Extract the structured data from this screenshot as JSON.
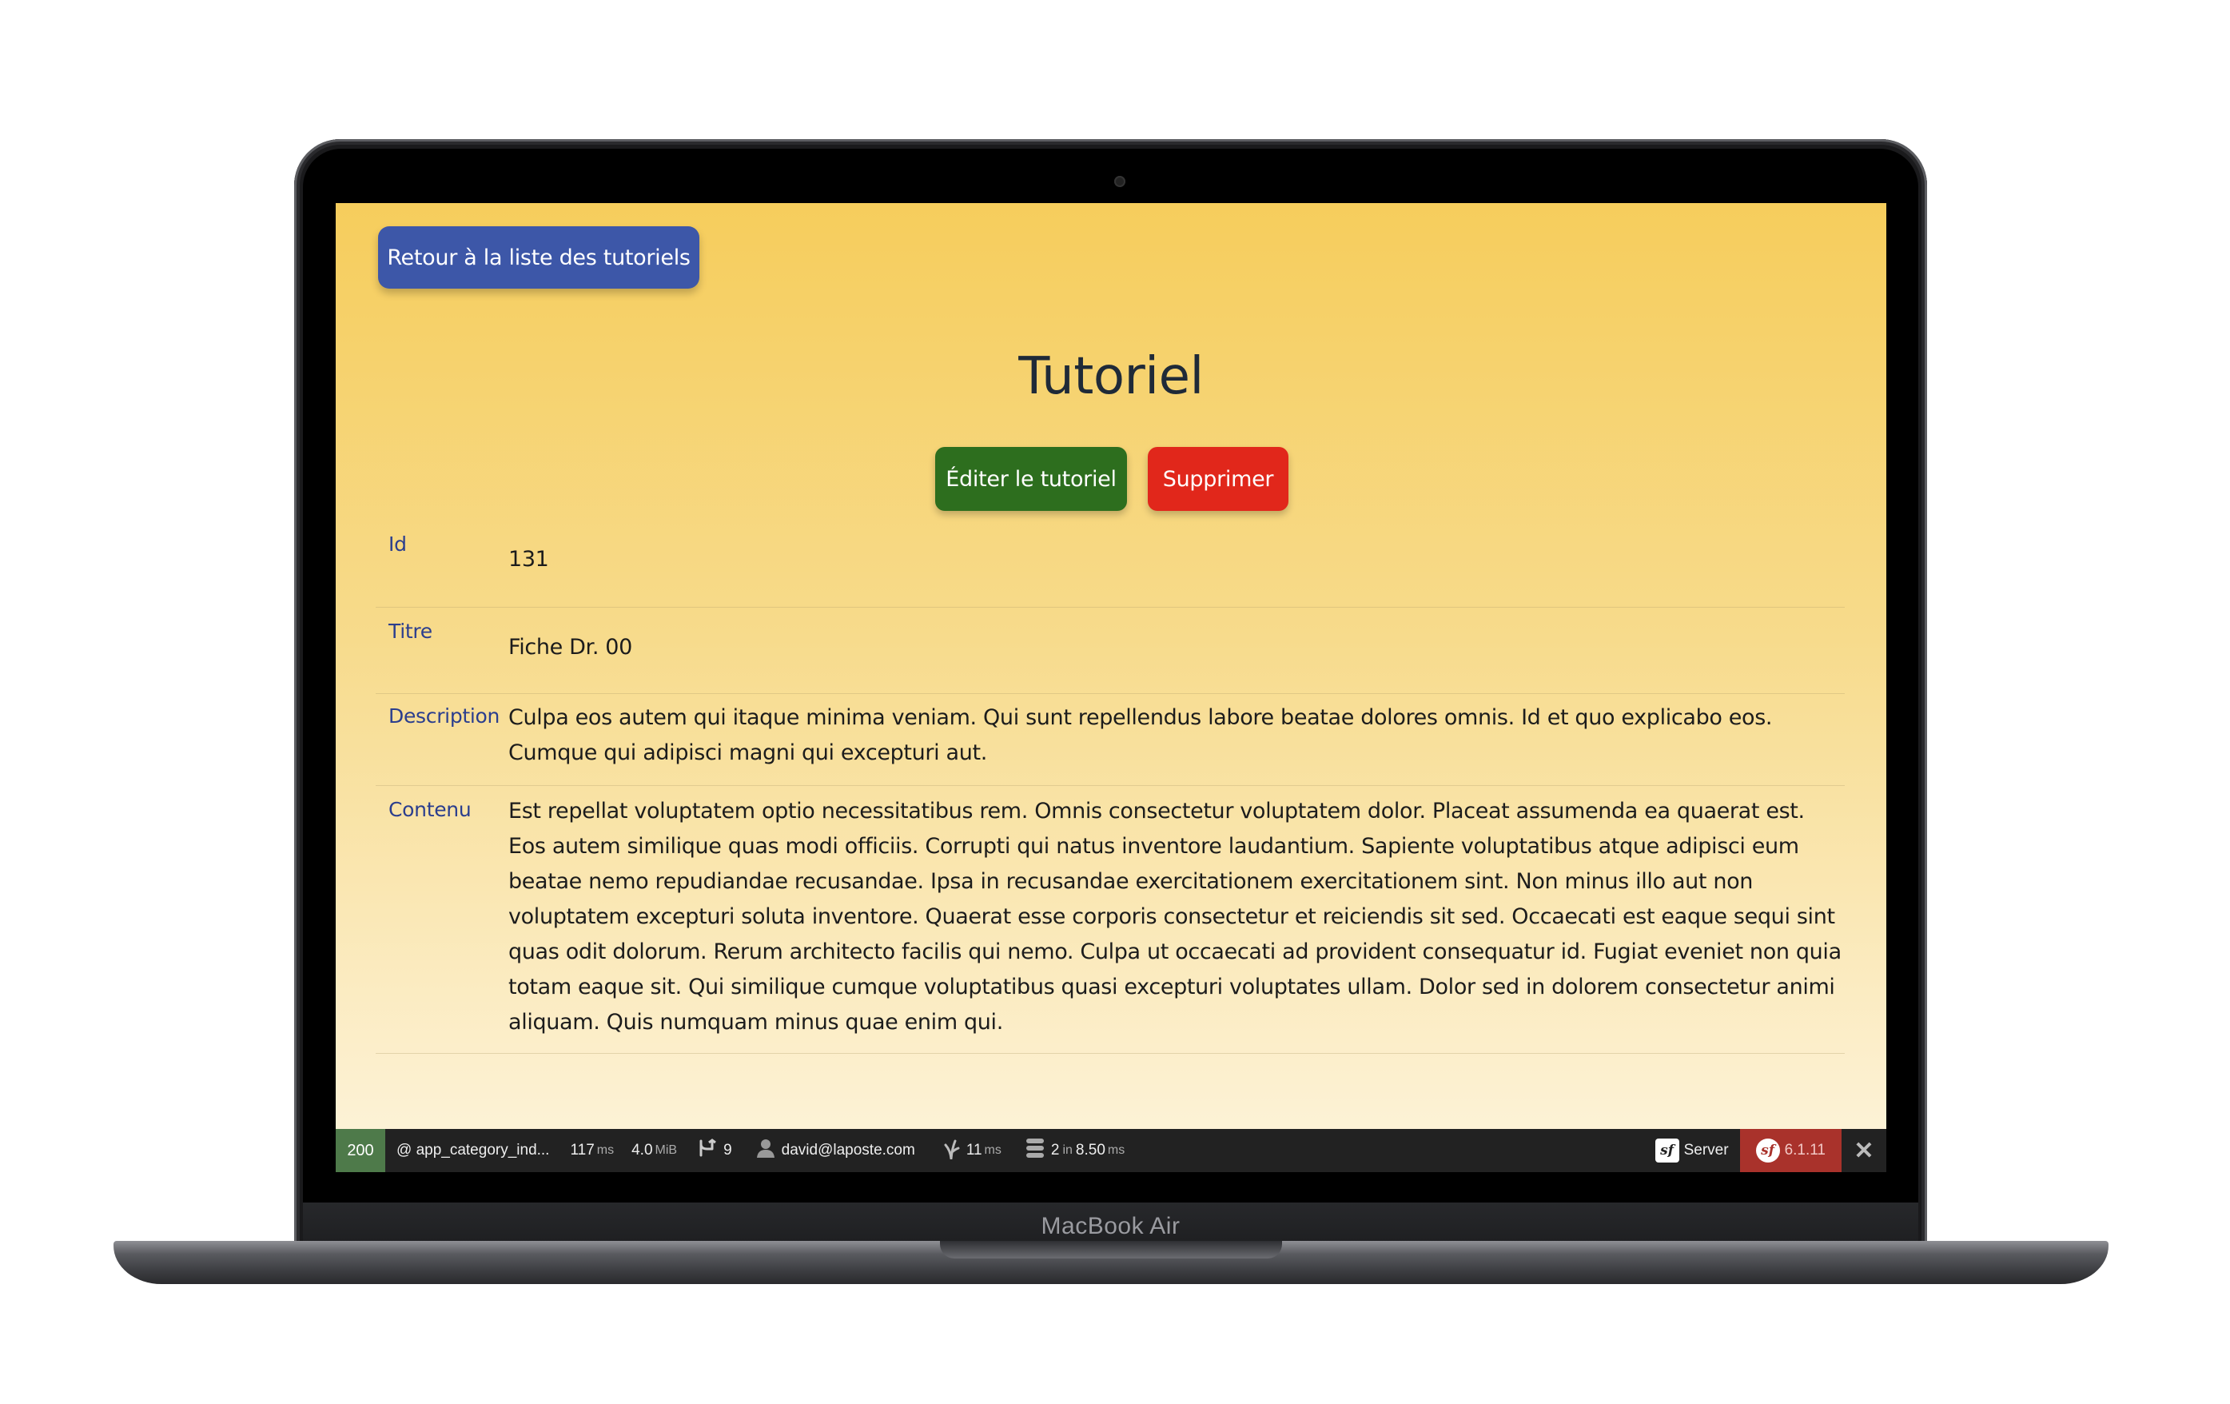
{
  "device": {
    "label": "MacBook Air"
  },
  "page": {
    "back_button": "Retour à la liste des tutoriels",
    "title": "Tutoriel",
    "edit_button": "Éditer le tutoriel",
    "delete_button": "Supprimer"
  },
  "details": [
    {
      "label": "Id",
      "value": "131"
    },
    {
      "label": "Titre",
      "value": "Fiche Dr. 00"
    },
    {
      "label": "Description",
      "value": "Culpa eos autem qui itaque minima veniam. Qui sunt repellendus labore beatae dolores omnis. Id et quo explicabo eos. Cumque qui adipisci magni qui excepturi aut."
    },
    {
      "label": "Contenu",
      "value": "Est repellat voluptatem optio necessitatibus rem. Omnis consectetur voluptatem dolor. Placeat assumenda ea quaerat est. Eos autem similique quas modi officiis. Corrupti qui natus inventore laudantium. Sapiente voluptatibus atque adipisci eum beatae nemo repudiandae recusandae. Ipsa in recusandae exercitationem exercitationem sint. Non minus illo aut non voluptatem excepturi soluta inventore. Quaerat esse corporis consectetur et reiciendis sit sed. Occaecati est eaque sequi sint quas odit dolorum. Rerum architecto facilis qui nemo. Culpa ut occaecati ad provident consequatur id. Fugiat eveniet non quia totam eaque sit. Qui similique cumque voluptatibus quasi excepturi voluptates ullam. Dolor sed in dolorem consectetur animi aliquam. Quis numquam minus quae enim qui."
    }
  ],
  "toolbar": {
    "status_code": "200",
    "route": "@ app_category_ind...",
    "time_value": "117",
    "time_unit": "ms",
    "memory_value": "4.0",
    "memory_unit": "MiB",
    "events_count": "9",
    "user": "david@laposte.com",
    "twig_value": "11",
    "twig_unit": "ms",
    "db_count": "2",
    "db_in": "in",
    "db_time": "8.50",
    "db_unit": "ms",
    "server_label": "Server",
    "version": "6.1.11",
    "icons": {
      "events": "branch-icon",
      "user": "user-icon",
      "twig": "twig-icon",
      "db": "database-icon",
      "symfony": "symfony-logo",
      "close": "close-icon"
    },
    "colors": {
      "status_bg": "#4e7a4a",
      "version_bg": "#a9322b",
      "bar_bg": "#222222"
    }
  },
  "colors": {
    "back_button": "#3d57a8",
    "edit_button": "#2d6e1e",
    "delete_button": "#e1271b",
    "label_text": "#2b3e8e",
    "gradient_top": "#f6cd5c",
    "gradient_bottom": "#fdf4dc"
  }
}
